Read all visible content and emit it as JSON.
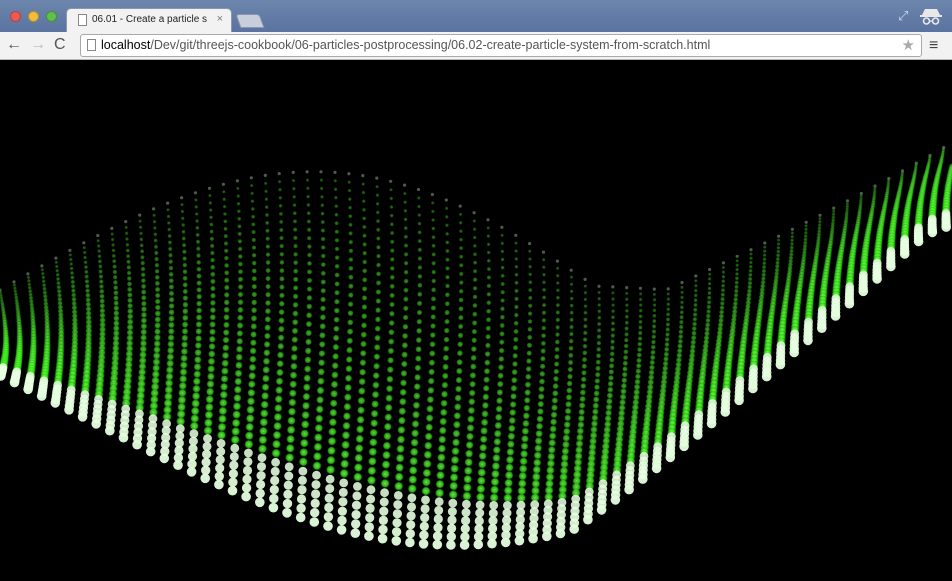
{
  "window": {
    "tab_title": "06.01 - Create a particle s",
    "tab_close": "×"
  },
  "toolbar": {
    "back_icon": "←",
    "forward_icon": "→",
    "reload_icon": "C",
    "star_icon": "★",
    "menu_icon": "≡",
    "url_host": "localhost",
    "url_path": "/Dev/git/threejs-cookbook/06-particles-postprocessing/06.02-create-particle-system-from-scratch.html"
  },
  "scene": {
    "particle_color": "#39ff14",
    "highlight_color": "#e6ffe0",
    "background": "#000000"
  }
}
